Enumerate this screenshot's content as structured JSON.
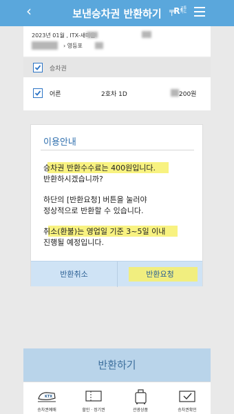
{
  "header": {
    "title": "보낸승차권 반환하기",
    "back_icon": "chevron-left-icon",
    "logo_mark": "╤R⁺",
    "logo_text": "교통카드",
    "menu_icon": "hamburger-icon",
    "color": "#5aa7dc"
  },
  "trip": {
    "line1": "2023년 01월          , ITX-새마을",
    "line2": "› 영등포"
  },
  "ticket_section": {
    "label": "승차권"
  },
  "ticket_row": {
    "passenger_type": "어른",
    "seat": "2호차 1D",
    "price": "200원"
  },
  "modal": {
    "title": "이용안내",
    "para1_line1": "승차권 반환수수료는 400원입니다.",
    "para1_line2": "반환하시겠습니까?",
    "para2_line1": "하단의 [반환요청] 버튼을 눌러야",
    "para2_line2": "정상적으로 반환할 수 있습니다.",
    "para3_line1": "취소(환불)는 영업일 기준 3~5일 이내",
    "para3_line2": "진행될 예정입니다.",
    "cancel_label": "반환취소",
    "confirm_label": "반환요청",
    "highlight_color": "#f7f06a"
  },
  "bottom_button": {
    "label": "반환하기"
  },
  "tabbar": {
    "items": [
      {
        "label": "승차권예매",
        "icon": "train-icon"
      },
      {
        "label": "할인 · 정기권",
        "icon": "ticket-icon"
      },
      {
        "label": "관광상품",
        "icon": "luggage-icon"
      },
      {
        "label": "승차권확인",
        "icon": "ticket-check-icon"
      }
    ]
  }
}
